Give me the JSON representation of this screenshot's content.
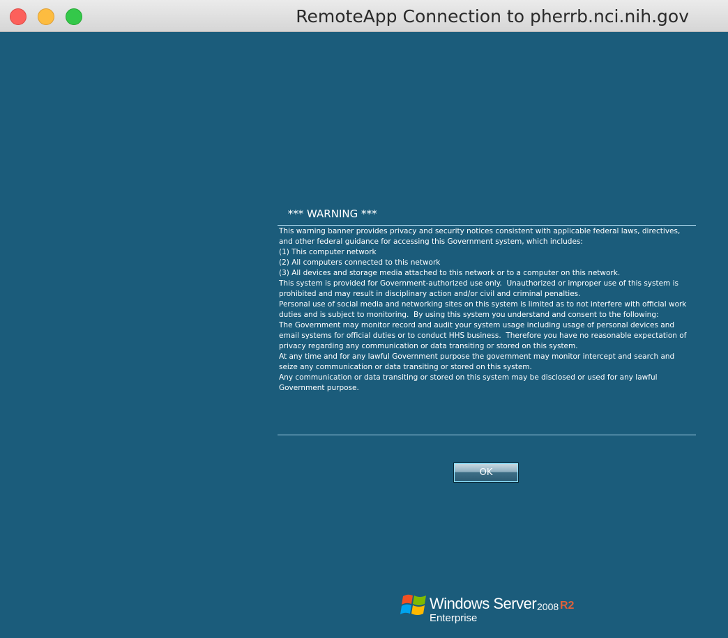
{
  "window": {
    "title": "RemoteApp Connection to pherrb.nci.nih.gov"
  },
  "banner": {
    "title": " *** WARNING ***",
    "lines": [
      "This warning banner provides privacy and security notices consistent with applicable federal laws, directives,",
      "and other federal guidance for accessing this Government system, which includes:",
      "(1) This computer network",
      "(2) All computers connected to this network",
      "(3) All devices and storage media attached to this network or to a computer on this network.",
      "This system is provided for Government-authorized use only.  Unauthorized or improper use of this system is",
      "prohibited and may result in disciplinary action and/or civil and criminal penalties.",
      "Personal use of social media and networking sites on this system is limited as to not interfere with official work",
      "duties and is subject to monitoring.  By using this system you understand and consent to the following:",
      "The Government may monitor record and audit your system usage including usage of personal devices and",
      "email systems for official duties or to conduct HHS business.  Therefore you have no reasonable expectation of",
      "privacy regarding any communication or data transiting or stored on this system.",
      "At any time and for any lawful Government purpose the government may monitor intercept and search and",
      "seize any communication or data transiting or stored on this system.",
      "Any communication or data transiting or stored on this system may be disclosed or used for any lawful",
      "Government purpose."
    ],
    "ok_label": "OK"
  },
  "logo": {
    "product": "Windows Server",
    "version": "2008",
    "release": "R2",
    "edition": "Enterprise",
    "icon": "windows-flag-icon"
  },
  "colors": {
    "background": "#1b5c7b",
    "rule": "#a8d4ea",
    "r2_accent": "#e0613a"
  }
}
